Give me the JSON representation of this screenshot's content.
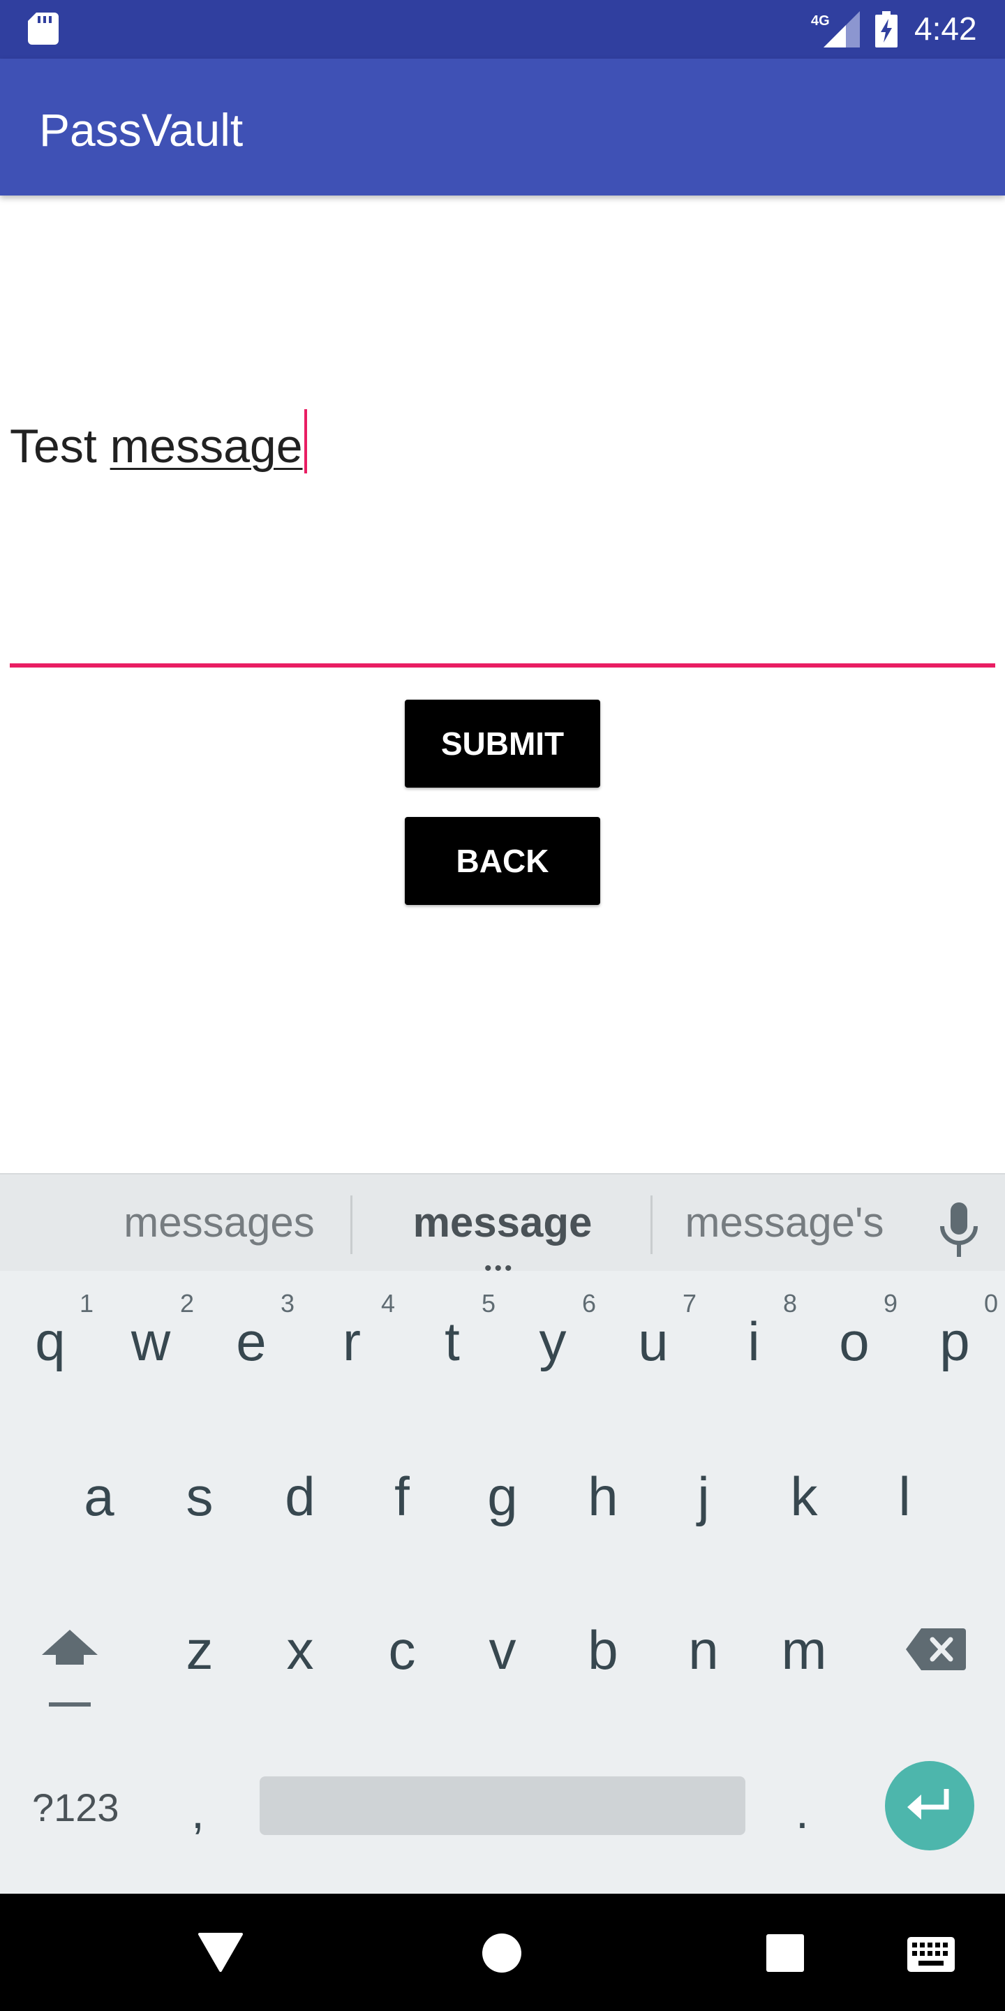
{
  "status_bar": {
    "time": "4:42",
    "network_label": "4G",
    "icons": [
      "sd-card-icon",
      "signal-icon",
      "battery-charging-icon"
    ],
    "color": "#303F9F"
  },
  "app_bar": {
    "title": "PassVault",
    "color": "#3F51B5"
  },
  "message_field": {
    "value_prefix": "Test ",
    "value_composing": "message",
    "accent_color": "#E91E63"
  },
  "buttons": {
    "submit_label": "SUBMIT",
    "back_label": "BACK"
  },
  "keyboard": {
    "suggestions": [
      "messages",
      "message",
      "message's"
    ],
    "row1": [
      {
        "key": "q",
        "hint": "1"
      },
      {
        "key": "w",
        "hint": "2"
      },
      {
        "key": "e",
        "hint": "3"
      },
      {
        "key": "r",
        "hint": "4"
      },
      {
        "key": "t",
        "hint": "5"
      },
      {
        "key": "y",
        "hint": "6"
      },
      {
        "key": "u",
        "hint": "7"
      },
      {
        "key": "i",
        "hint": "8"
      },
      {
        "key": "o",
        "hint": "9"
      },
      {
        "key": "p",
        "hint": "0"
      }
    ],
    "row2": [
      "a",
      "s",
      "d",
      "f",
      "g",
      "h",
      "j",
      "k",
      "l"
    ],
    "row3": [
      "z",
      "x",
      "c",
      "v",
      "b",
      "n",
      "m"
    ],
    "symbols_label": "?123",
    "comma": ",",
    "period": ".",
    "enter_color": "#4DB6AC"
  },
  "nav_bar": {
    "icons": [
      "back-icon",
      "home-icon",
      "recents-icon",
      "keyboard-icon"
    ]
  }
}
